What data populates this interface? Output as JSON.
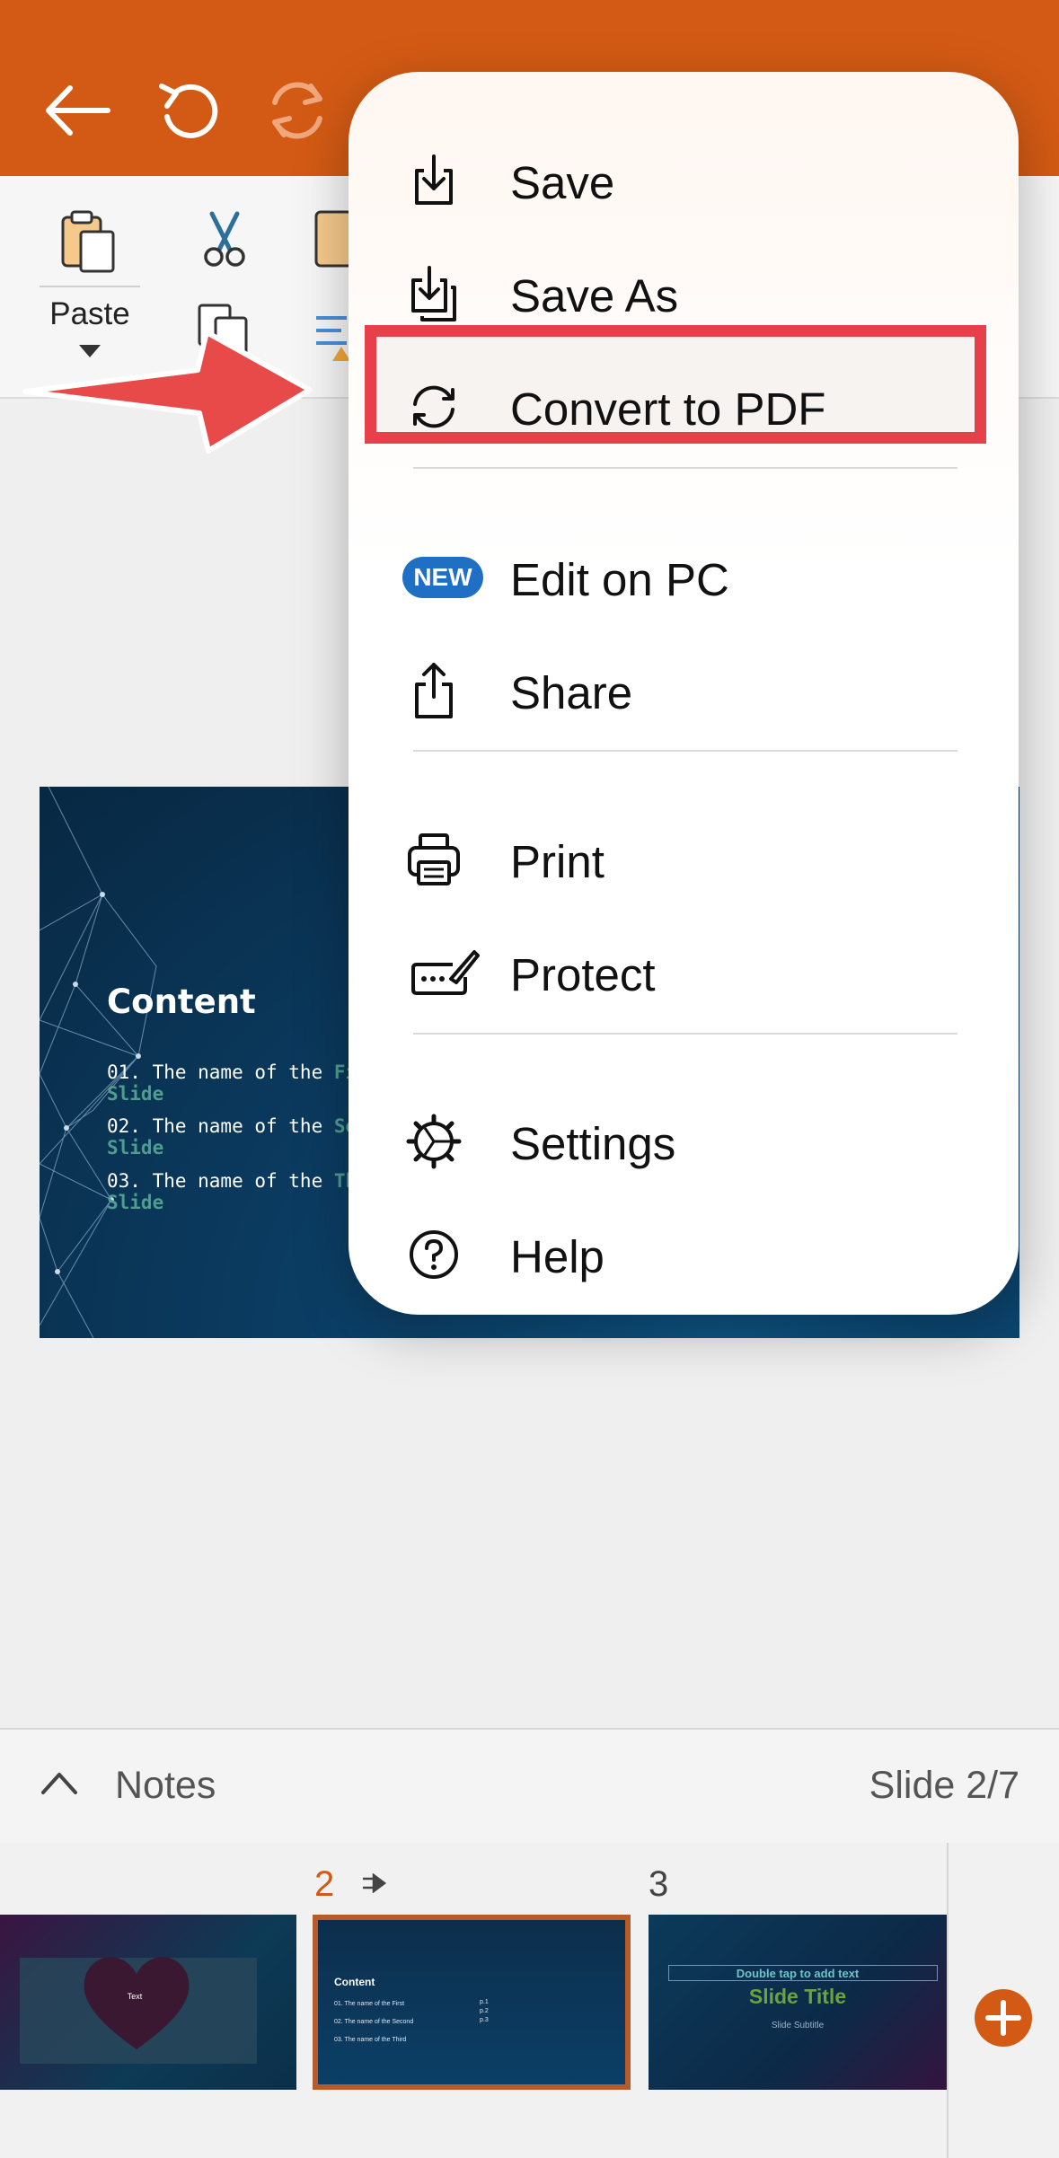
{
  "ribbon": {
    "paste_label": "Paste"
  },
  "slide": {
    "title": "Content",
    "items": [
      {
        "prefix": "01. The name of the ",
        "highlight": "First",
        "suffix": "Slide"
      },
      {
        "prefix": "02. The name of the ",
        "highlight": "Seco",
        "suffix": "Slide"
      },
      {
        "prefix": "03. The name of the ",
        "highlight": "Third",
        "suffix": "Slide"
      }
    ]
  },
  "menu": {
    "items": [
      {
        "label": "Save",
        "icon": "save-icon"
      },
      {
        "label": "Save As",
        "icon": "save-as-icon"
      },
      {
        "label": "Convert to PDF",
        "icon": "convert-icon"
      },
      {
        "label": "Edit on PC",
        "icon": "new-badge",
        "badge": "NEW"
      },
      {
        "label": "Share",
        "icon": "share-icon"
      },
      {
        "label": "Print",
        "icon": "printer-icon"
      },
      {
        "label": "Protect",
        "icon": "protect-icon"
      },
      {
        "label": "Settings",
        "icon": "gear-icon"
      },
      {
        "label": "Help",
        "icon": "help-icon"
      }
    ]
  },
  "notes": {
    "label": "Notes",
    "slide_indicator": "Slide 2/7"
  },
  "thumbnails": [
    {
      "number": "",
      "text": "Text"
    },
    {
      "number": "2",
      "title": "Content",
      "lines": [
        "01. The name of the First",
        "02. The name of the Second",
        "03. The name of the Third"
      ],
      "pages": [
        "p.1",
        "p.2",
        "p.3"
      ]
    },
    {
      "number": "3",
      "hint": "Double tap to add text",
      "title": "Slide Title",
      "subtitle": "Slide Subtitle"
    }
  ],
  "colors": {
    "accent": "#d35a14",
    "highlight_box": "#e8404a",
    "arrow": "#e84a4a",
    "new_badge": "#1f6fc5"
  }
}
